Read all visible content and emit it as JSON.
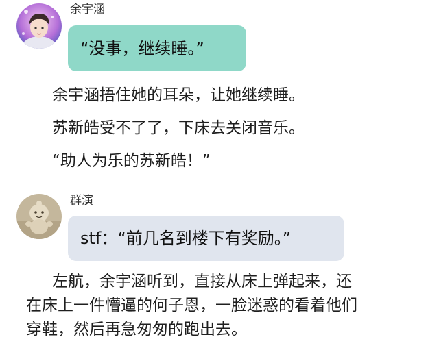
{
  "messages": [
    {
      "speaker": "余宇涵",
      "avatar_icon": "boy-portrait-avatar",
      "bubble_color": "#8fd8c8",
      "text": "“没事，继续睡。”"
    },
    {
      "speaker": "群演",
      "avatar_icon": "clay-figure-avatar",
      "bubble_color": "#e0e5ee",
      "text": "stf：“前几名到楼下有奖励。”"
    }
  ],
  "narration": [
    "余宇涵捂住她的耳朵，让她继续睡。",
    "苏新皓受不了了，下床去关闭音乐。",
    "“助人为乐的苏新皓！”"
  ],
  "closing_paragraph": {
    "lines": [
      "左航，余宇涵听到，直接从床上弹起来，还",
      "在床上一件懵逼的何子恩，一脸迷惑的看着他们",
      "穿鞋，然后再急匆匆的跑出去。"
    ]
  }
}
